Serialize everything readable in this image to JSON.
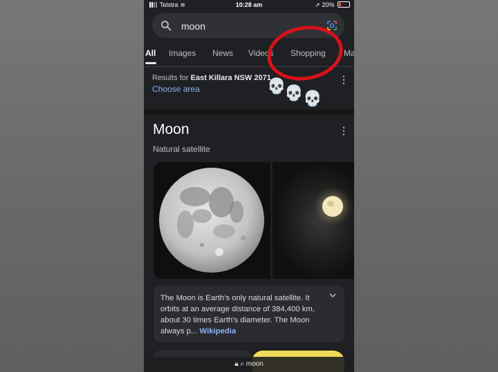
{
  "status_bar": {
    "carrier": "Telstra",
    "time": "10:28 am",
    "battery": "20%"
  },
  "search": {
    "query": "moon"
  },
  "tabs": [
    {
      "label": "All",
      "active": true
    },
    {
      "label": "Images",
      "active": false
    },
    {
      "label": "News",
      "active": false
    },
    {
      "label": "Videos",
      "active": false
    },
    {
      "label": "Shopping",
      "active": false
    },
    {
      "label": "Ma",
      "active": false
    }
  ],
  "location": {
    "prefix": "Results for",
    "place": "East Killara NSW 2071",
    "choose_area": "Choose area"
  },
  "annotation": {
    "emoji": "💀",
    "circle_color": "#d9121b"
  },
  "knowledge_panel": {
    "title": "Moon",
    "subtitle": "Natural satellite",
    "description": "The Moon is Earth's only natural satellite. It orbits at an average distance of 384,400 km, about 30 times Earth's diameter. The Moon always p...",
    "source": "Wikipedia"
  },
  "url_bar": {
    "text": "moon"
  },
  "colors": {
    "background": "#1f2023",
    "link": "#8ab4f8",
    "accent_yellow": "#f1dc5a"
  }
}
